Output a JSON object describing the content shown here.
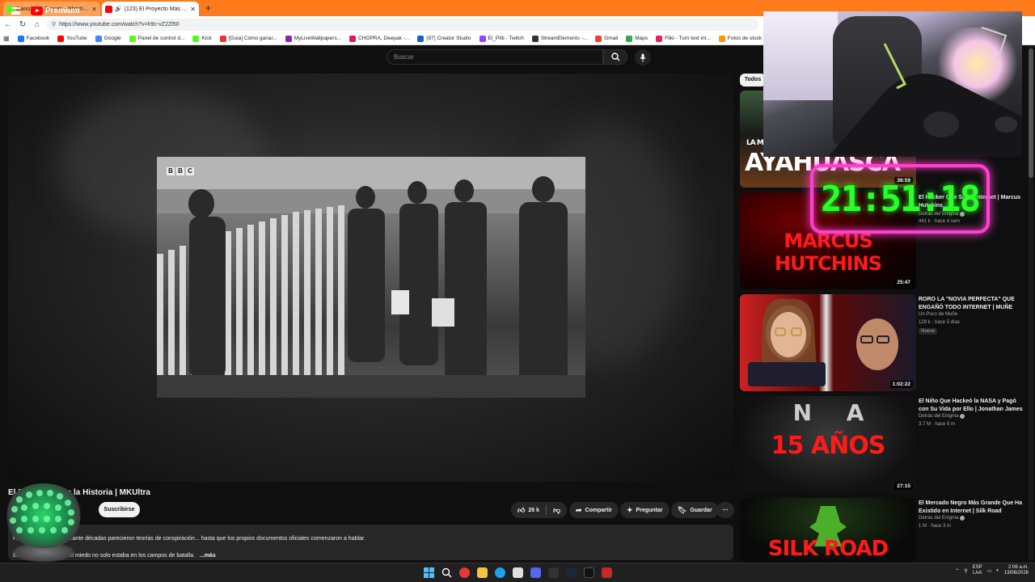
{
  "browser": {
    "tabs": [
      {
        "title": "Gano2000 Stream - Watch Live o...",
        "active": false,
        "favicon_color": "#53fc18"
      },
      {
        "title": "(123) El Proyecto Más Oscuro...",
        "active": true,
        "favicon_color": "#ff0000"
      }
    ],
    "new_tab": "+",
    "url": "https://www.youtube.com/watch?v=h9c-vZ2Zl50",
    "bookmarks": [
      {
        "label": "Facebook",
        "color": "#1877f2"
      },
      {
        "label": "YouTube",
        "color": "#ff0000"
      },
      {
        "label": "Google",
        "color": "#4285f4"
      },
      {
        "label": "Panel de control d...",
        "color": "#53fc18"
      },
      {
        "label": "Kick",
        "color": "#53fc18"
      },
      {
        "label": "[Guia] Cómo ganar...",
        "color": "#e53935"
      },
      {
        "label": "MyLiveWallpapers...",
        "color": "#8e24aa"
      },
      {
        "label": "CHOPRA, Deepak -...",
        "color": "#d81b60"
      },
      {
        "label": "(97) Creator Studio",
        "color": "#1565c0"
      },
      {
        "label": "El_Pitti - Twitch",
        "color": "#9146ff"
      },
      {
        "label": "StreamElements -...",
        "color": "#333333"
      },
      {
        "label": "Gmail",
        "color": "#ea4335"
      },
      {
        "label": "Maps",
        "color": "#34a853"
      },
      {
        "label": "Fliki - Turn text int...",
        "color": "#e91e63"
      },
      {
        "label": "Fotos de stock gra...",
        "color": "#ff9800"
      }
    ]
  },
  "youtube": {
    "logo_text": "Premium",
    "logo_country": "CO",
    "search_placeholder": "Buscar",
    "chip_all": "Todos",
    "video_title": "El Proyecto Más Oscuro de la Historia | MKUltra",
    "video_title_visible": "El P... Oscuro de la Historia | MKUltra",
    "subscribe": "Suscribirse",
    "likes": "26 k",
    "share": "Compartir",
    "ask": "Preguntar",
    "save": "Guardar",
    "description_line1": "Hay programas que durante décadas parecieron teorías de conspiración... hasta que los propios documentos oficiales comenzaron a hablar.",
    "description_line2": "En plena Guerra Fría, el miedo no solo estaba en los campos de batalla.",
    "more": "...más",
    "watermark": "BBC"
  },
  "sidebar": [
    {
      "thumb_text": "AYAHUASCA",
      "thumb_subtext": "LA MEDI",
      "duration": "38:59",
      "title": "",
      "channel": "",
      "meta": "",
      "badge": ""
    },
    {
      "thumb_text": "MARCUS HUTCHINS",
      "duration": "25:47",
      "title": "El Hacker Que Salvó Internet | Marcus Hutchins",
      "channel": "Detrás del Enigma",
      "meta": "441 k · hace 4 sem",
      "badge": ""
    },
    {
      "thumb_text": "",
      "duration": "1:02:22",
      "title": "RORO LA \"NOVIA PERFECTA\" QUE ENGAÑÓ TODO INTERNET | MUÑE",
      "channel": "Un Poco de Muñe",
      "meta": "129 k · hace 5 días",
      "badge": "Nuevo"
    },
    {
      "thumb_text": "15 AÑOS",
      "duration": "27:15",
      "title": "El Niño Que Hackeó la NASA y Pagó con Su Vida por Ello | Jonathan James",
      "channel": "Detrás del Enigma",
      "meta": "3.7 M · hace 5 m",
      "badge": ""
    },
    {
      "thumb_text": "SILK ROAD",
      "duration": "",
      "title": "El Mercado Negro Más Grande Que Ha Existido en Internet | Silk Road",
      "channel": "Detrás del Enigma",
      "meta": "1 M · hace 3 m",
      "badge": ""
    }
  ],
  "overlay": {
    "clock": "21:51:18",
    "clock_color": "#2aff2a",
    "frame_color": "#ff3fd0"
  },
  "taskbar": {
    "lang_top": "ESP",
    "lang_bottom": "LAA",
    "time": "2:06 a.m.",
    "date": "13/08/2026"
  }
}
